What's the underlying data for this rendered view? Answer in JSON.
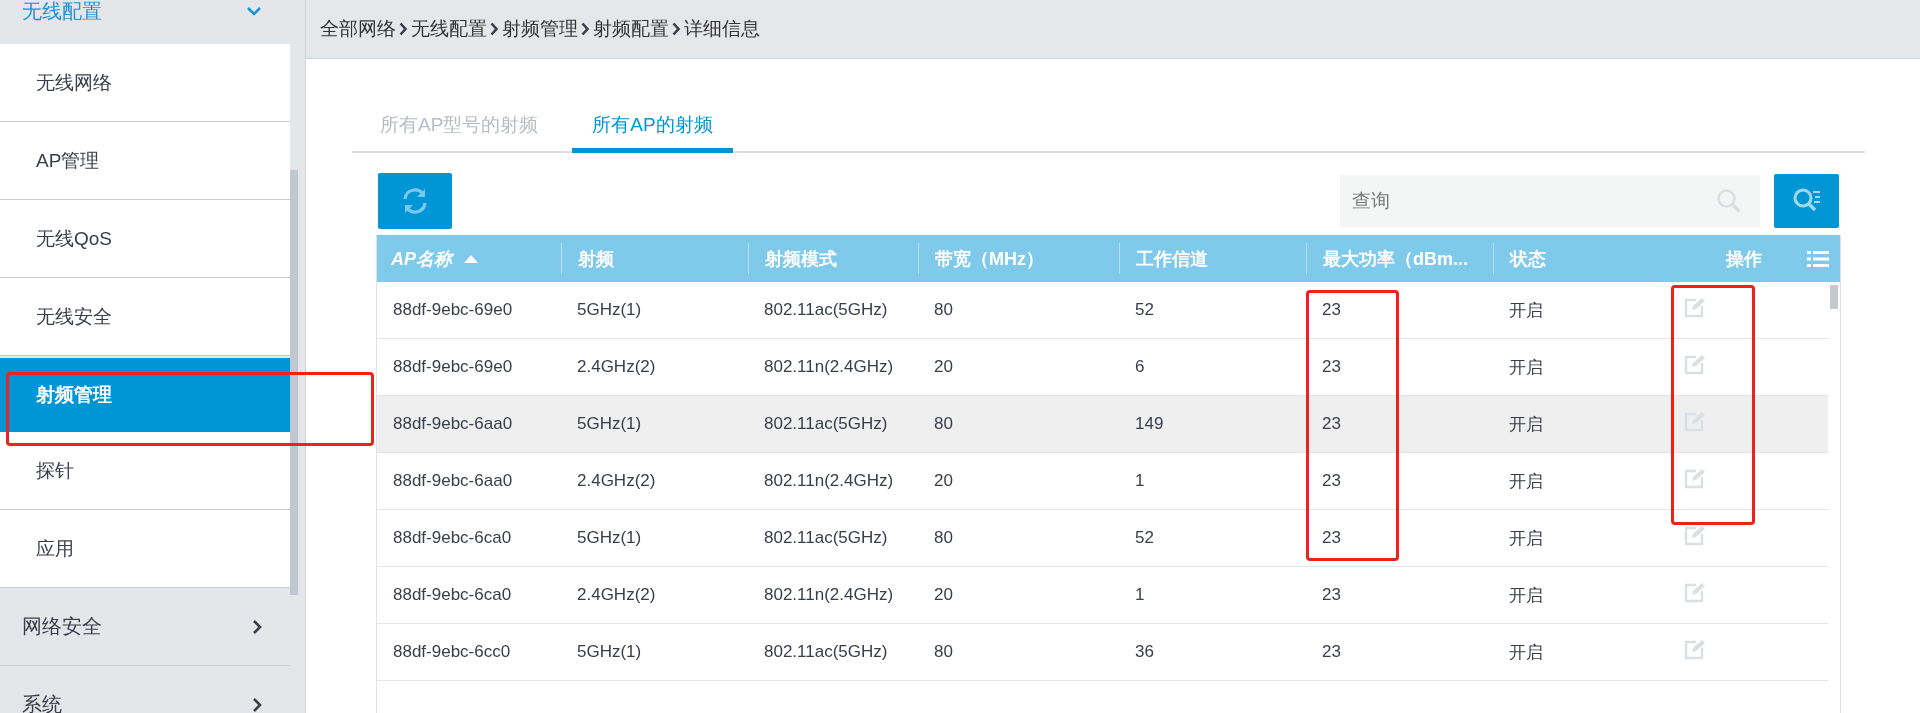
{
  "sidebar": {
    "groups": [
      {
        "label": "无线配置",
        "expanded": true,
        "items": [
          {
            "label": "无线网络",
            "selected": false,
            "framed": false
          },
          {
            "label": "AP管理",
            "selected": false,
            "framed": false
          },
          {
            "label": "无线QoS",
            "selected": false,
            "framed": false
          },
          {
            "label": "无线安全",
            "selected": false,
            "framed": false
          },
          {
            "label": "射频管理",
            "selected": true,
            "framed": true
          },
          {
            "label": "探针",
            "selected": false,
            "framed": false
          },
          {
            "label": "应用",
            "selected": false,
            "framed": false
          }
        ]
      },
      {
        "label": "网络安全",
        "expanded": false
      },
      {
        "label": "系统",
        "expanded": false
      }
    ]
  },
  "breadcrumb": [
    "全部网络",
    "无线配置",
    "射频管理",
    "射频配置",
    "详细信息"
  ],
  "tabs": [
    {
      "label": "所有AP型号的射频",
      "selected": false
    },
    {
      "label": "所有AP的射频",
      "selected": true
    }
  ],
  "search": {
    "placeholder": "查询"
  },
  "table": {
    "columns": [
      {
        "label": "AP名称",
        "sorted": true
      },
      {
        "label": "射频",
        "sorted": false
      },
      {
        "label": "射频模式",
        "sorted": false
      },
      {
        "label": "带宽（MHz）",
        "sorted": false
      },
      {
        "label": "工作信道",
        "sorted": false
      },
      {
        "label": "最大功率（dBm...",
        "sorted": false
      },
      {
        "label": "状态",
        "sorted": false
      },
      {
        "label": "操作",
        "sorted": false
      }
    ],
    "rows": [
      {
        "cells": [
          "88df-9ebc-69e0",
          "5GHz(1)",
          "802.11ac(5GHz)",
          "80",
          "52",
          "23",
          "开启"
        ],
        "shaded": false,
        "power_framed": true,
        "action_framed": true
      },
      {
        "cells": [
          "88df-9ebc-69e0",
          "2.4GHz(2)",
          "802.11n(2.4GHz)",
          "20",
          "6",
          "23",
          "开启"
        ],
        "shaded": false,
        "power_framed": true,
        "action_framed": true
      },
      {
        "cells": [
          "88df-9ebc-6aa0",
          "5GHz(1)",
          "802.11ac(5GHz)",
          "80",
          "149",
          "23",
          "开启"
        ],
        "shaded": true,
        "power_framed": true,
        "action_framed": true
      },
      {
        "cells": [
          "88df-9ebc-6aa0",
          "2.4GHz(2)",
          "802.11n(2.4GHz)",
          "20",
          "1",
          "23",
          "开启"
        ],
        "shaded": false,
        "power_framed": true,
        "action_framed": true
      },
      {
        "cells": [
          "88df-9ebc-6ca0",
          "5GHz(1)",
          "802.11ac(5GHz)",
          "80",
          "52",
          "23",
          "开启"
        ],
        "shaded": false,
        "power_framed": true,
        "action_framed": false
      },
      {
        "cells": [
          "88df-9ebc-6ca0",
          "2.4GHz(2)",
          "802.11n(2.4GHz)",
          "20",
          "1",
          "23",
          "开启"
        ],
        "shaded": false,
        "power_framed": false,
        "action_framed": false
      },
      {
        "cells": [
          "88df-9ebc-6cc0",
          "5GHz(1)",
          "802.11ac(5GHz)",
          "80",
          "36",
          "23",
          "开启"
        ],
        "shaded": false,
        "power_framed": false,
        "action_framed": false
      }
    ]
  }
}
